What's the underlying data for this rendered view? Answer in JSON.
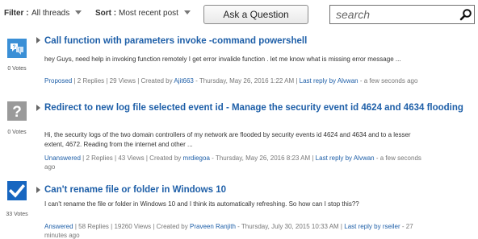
{
  "toolbar": {
    "filter_label": "Filter :",
    "filter_value": "All threads",
    "sort_label": "Sort :",
    "sort_value": "Most recent post",
    "ask_label": "Ask a Question",
    "search_placeholder": "search"
  },
  "colors": {
    "link": "#1e5fa8",
    "status_unanswered": "#9a9a9a",
    "status_answered": "#1766c0",
    "status_proposed": "#3a8fd6"
  },
  "threads": [
    {
      "status_icon": "proposed-answer-icon",
      "votes": "0 Votes",
      "title": "Call function with parameters invoke -command powershell",
      "excerpt": "hey Guys, need help in invoking function remotely I get error invalide function . let me know what is missing error message ...",
      "status": "Proposed",
      "stats": "| 2 Replies | 29 Views | Created by",
      "author": "Ajit663",
      "created": "- Thursday, May 26, 2016 1:22 AM |",
      "last_reply_label": "Last reply",
      "by": "by",
      "last_reply_author": "Alvwan",
      "last_reply_time": "- a few seconds ago"
    },
    {
      "status_icon": "question-mark-icon",
      "votes": "0 Votes",
      "title": "Redirect to new log file selected event id - Manage the security event id 4624 and 4634 flooding",
      "excerpt": "Hi, the security logs of the two domain controllers of my network are flooded by security events id 4624 and 4634 and to a lesser extent, 4672. Reading from the internet and other ...",
      "status": "Unanswered",
      "stats": "| 2 Replies | 43 Views | Created by",
      "author": "mrdiegoa",
      "created": "- Thursday, May 26, 2016 8:23 AM |",
      "last_reply_label": "Last reply",
      "by": "by",
      "last_reply_author": "Alvwan",
      "last_reply_time": "- a few seconds ago"
    },
    {
      "status_icon": "answered-check-icon",
      "votes": "33 Votes",
      "title": "Can't rename file or folder in Windows 10",
      "excerpt": "I can't rename the file or folder in Windows 10 and I think its automatically refreshing. So how can I stop this??",
      "status": "Answered",
      "stats": "| 58 Replies | 19260 Views | Created by",
      "author": "Praveen Ranjith",
      "created": "- Thursday, July 30, 2015 10:33 AM |",
      "last_reply_label": "Last reply",
      "by": "by",
      "last_reply_author": "rseiler",
      "last_reply_time": "- 27 minutes ago"
    }
  ]
}
